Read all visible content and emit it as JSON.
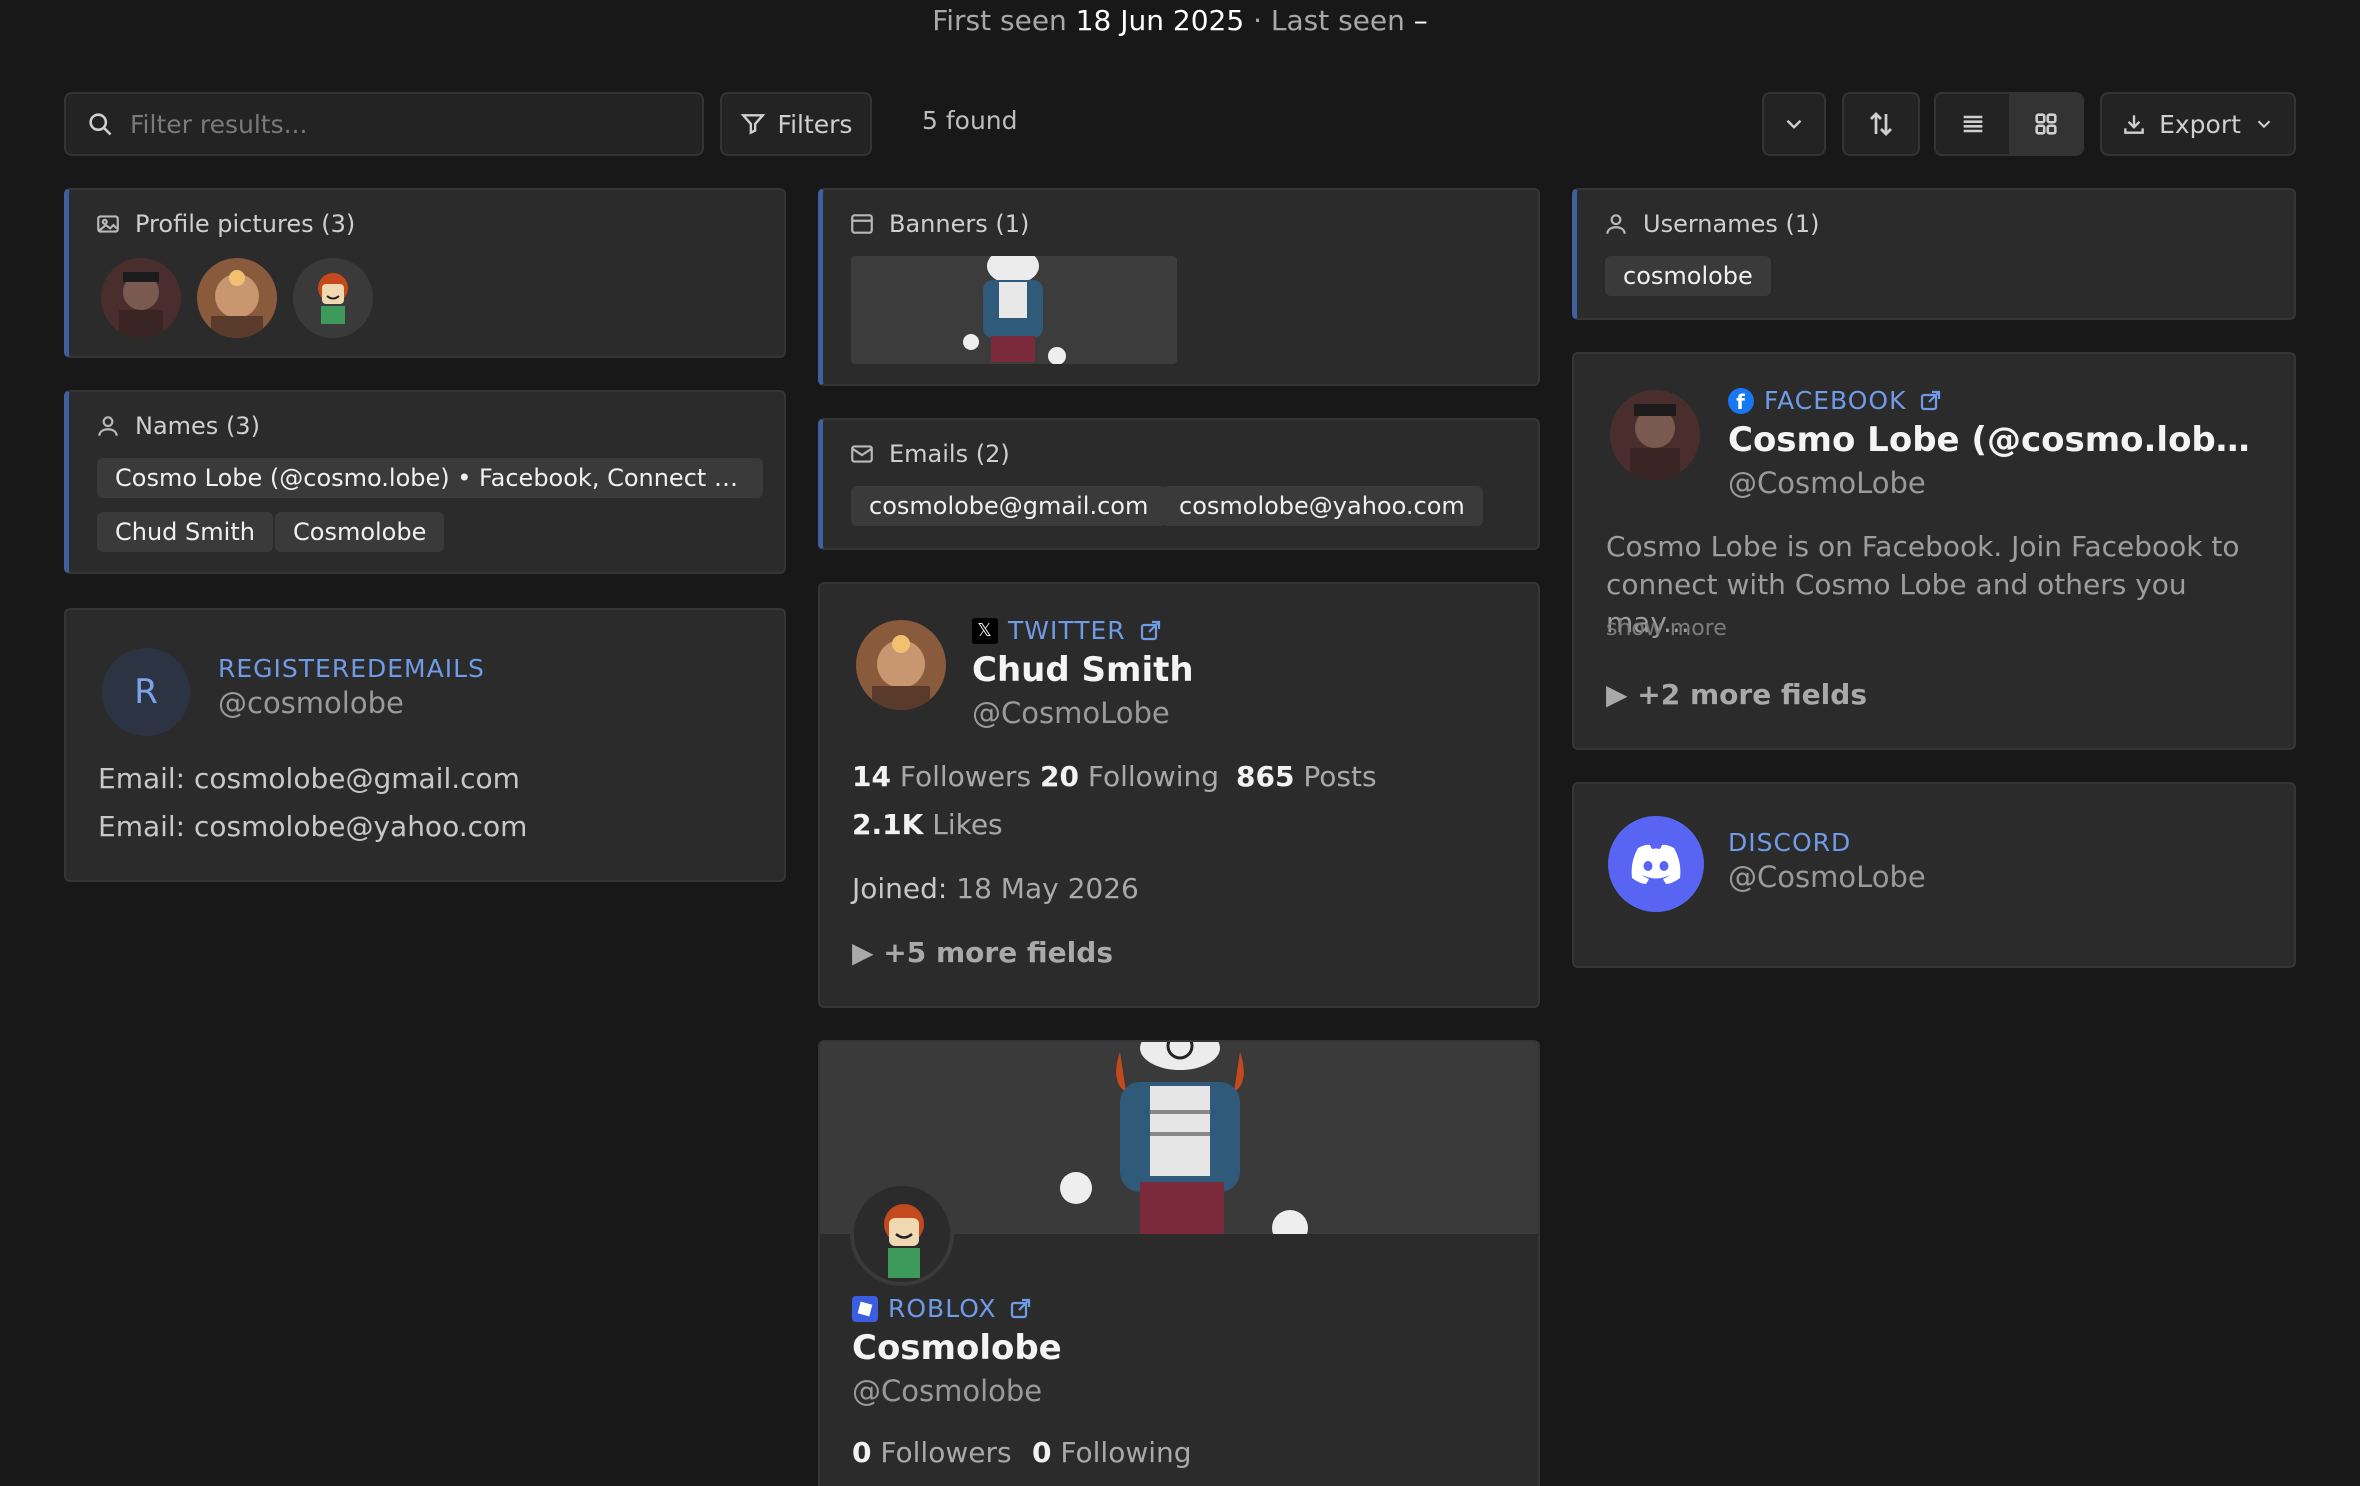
{
  "header": {
    "first_seen_label": "First seen",
    "first_seen_value": "18 Jun 2025",
    "separator": "·",
    "last_seen_label": "Last seen",
    "last_seen_value": "–"
  },
  "toolbar": {
    "search_placeholder": "Filter results...",
    "filters_label": "Filters",
    "found_count": "5 found",
    "export_label": "Export",
    "view_mode": "grid"
  },
  "profile_pictures": {
    "title": "Profile pictures (3)"
  },
  "names": {
    "title": "Names (3)",
    "items": [
      "Cosmo Lobe (@cosmo.lobe) • Facebook, Connect with ...",
      "Chud Smith",
      "Cosmolobe"
    ]
  },
  "registered_emails": {
    "avatar_letter": "R",
    "platform": "REGISTEREDEMAILS",
    "handle": "@cosmolobe",
    "lines": [
      {
        "label": "Email:",
        "value": "cosmolobe@gmail.com"
      },
      {
        "label": "Email:",
        "value": "cosmolobe@yahoo.com"
      }
    ]
  },
  "banners": {
    "title": "Banners (1)"
  },
  "emails": {
    "title": "Emails (2)",
    "items": [
      "cosmolobe@gmail.com",
      "cosmolobe@yahoo.com"
    ]
  },
  "twitter": {
    "platform": "TWITTER",
    "name": "Chud Smith",
    "handle": "@CosmoLobe",
    "followers_value": "14",
    "followers_label": "Followers",
    "following_value": "20",
    "following_label": "Following",
    "posts_value": "865",
    "posts_label": "Posts",
    "likes_value": "2.1K",
    "likes_label": "Likes",
    "joined_label": "Joined:",
    "joined_value": "18 May 2026",
    "more_fields": "▶ +5 more fields"
  },
  "roblox": {
    "platform": "ROBLOX",
    "name": "Cosmolobe",
    "handle": "@Cosmolobe",
    "followers_value": "0",
    "followers_label": "Followers",
    "following_value": "0",
    "following_label": "Following"
  },
  "usernames": {
    "title": "Usernames (1)",
    "items": [
      "cosmolobe"
    ]
  },
  "facebook": {
    "platform": "FACEBOOK",
    "name": "Cosmo Lobe (@cosmo.lobe) • Fa...",
    "handle": "@CosmoLobe",
    "description": "Cosmo Lobe is on Facebook. Join Facebook to connect with Cosmo Lobe and others you may...",
    "show_more": "show more",
    "more_fields": "▶ +2 more fields"
  },
  "discord": {
    "platform": "DISCORD",
    "handle": "@CosmoLobe"
  },
  "colors": {
    "background": "#181818",
    "card": "#2b2b2b",
    "accent_border": "#3f5f9f",
    "link_blue": "#6f9be8",
    "discord_blurple": "#5865f2"
  }
}
